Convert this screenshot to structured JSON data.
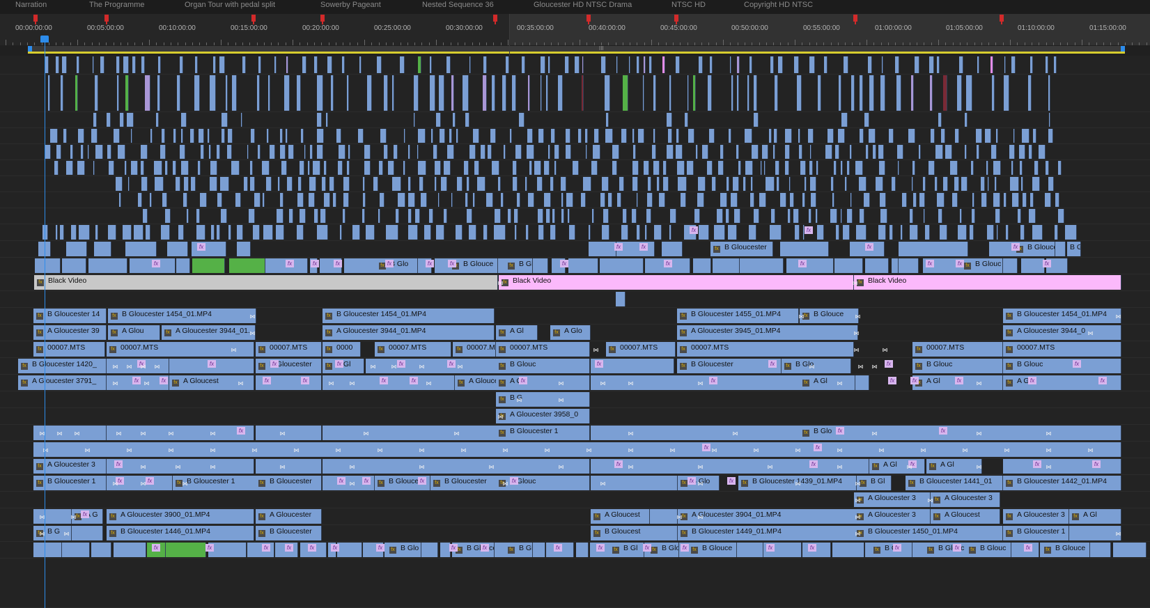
{
  "markers": {
    "labels": [
      "Narration",
      "The Programme",
      "Organ Tour with pedal split",
      "Sowerby Pageant",
      "Nested Sequence 36",
      "Gloucester HD NTSC Drama",
      "NTSC HD",
      "Copyright HD NTSC"
    ]
  },
  "ruler": {
    "timecodes": [
      "00:00:00:00",
      "00:05:00:00",
      "00:10:00:00",
      "00:15:00:00",
      "00:20:00:00",
      "00:25:00:00",
      "00:30:00:00",
      "00:35:00:00",
      "00:40:00:00",
      "00:45:00:00",
      "00:50:00:00",
      "00:55:00:00",
      "01:00:00:00",
      "01:05:00:00",
      "01:10:00:00",
      "01:15:00:00"
    ],
    "work_area_label": "III"
  },
  "colors": {
    "clip_video": "#7b9fd4",
    "clip_green": "#55b147",
    "clip_lilac": "#a996d6",
    "black_video_gray": "#c8c8c8",
    "black_video_pink": "#fbb9fb",
    "playhead": "#2d8ceb",
    "marker": "#d22a2a",
    "work_area_bar": "#d7cd2e"
  },
  "icons": {
    "fx": "fx-badge-icon",
    "transition": "transition-icon"
  },
  "labels": {
    "black_video": "Black Video",
    "bg1454": "B Gloucester 1454_01.MP4",
    "ag3944": "A Gloucester 3944_01.MP4",
    "bg1455": "B Gloucester 1455_01.MP4",
    "ag3945": "A Gloucester 3945_01.MP4",
    "ag3944_s": "A Gloucester 3944_01.",
    "bg1454_s": "B Gloucester 1454_01.MP4",
    "bg1454_r": "B Gloucester 1454_01.MP4",
    "ag3944_r": "A Gloucester 3944_0",
    "mts": "00007.MTS",
    "mts_s": "0000",
    "bg14_s": "B Gloucester 14",
    "ag39_s": "A Gloucester 39",
    "ag_glou": "A Glou",
    "bg1420": "B Gloucester 1420_",
    "ag3791": "A Gloucester 3791_",
    "bg_gloucester": "B Gloucester",
    "ag_gloucest": "A Gloucest",
    "ag_gloucester": "A Gloucester",
    "b_gl": "B Gl",
    "b_glo": "B Glo",
    "b_glouc": "B Glouc",
    "b_glouce": "B Glouce",
    "b_gloucest": "B Gloucest",
    "b_gloucester": "B Gloucester",
    "b_gloucester1": "B Gloucester 1",
    "a_gl": "A Gl",
    "a_glo": "A Glo",
    "a_g": "A G",
    "b_g": "B G",
    "ag3958": "A Gloucester 3958_0",
    "ag3": "A Gloucester 3",
    "bg1": "B Gloucester 1",
    "bg1439": "B Gloucester 1439_01.MP4",
    "bg1441": "B Gloucester 1441_01",
    "bg1442": "B Gloucester 1442_01.MP4",
    "ag3900": "A Gloucester 3900_01.MP4",
    "ag3904": "A Gloucester 3904_01.MP4",
    "bg1446": "B Gloucester 1446_01.MP4",
    "bg1449": "B Gloucester 1449_01.MP4",
    "bg1450": "B Gloucester 1450_01.MP4",
    "ag3_s": "A Gloucester 3",
    "b_gloucester_s": "B Gloucester",
    "b_glouce_s": "B Glouce",
    "b_glo_s": "B Glo"
  }
}
